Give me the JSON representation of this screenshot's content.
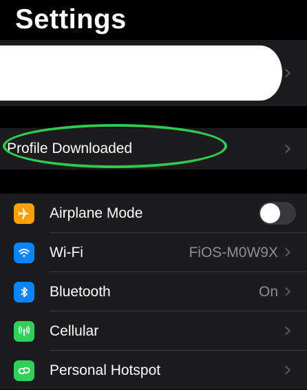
{
  "header": {
    "title": "Settings"
  },
  "profile": {
    "label": "Profile Downloaded"
  },
  "rows": [
    {
      "label": "Airplane Mode",
      "value": "",
      "icon": "airplane-icon",
      "color": "#ff9f0a"
    },
    {
      "label": "Wi-Fi",
      "value": "FiOS-M0W9X",
      "icon": "wifi-icon",
      "color": "#0a84ff"
    },
    {
      "label": "Bluetooth",
      "value": "On",
      "icon": "bluetooth-icon",
      "color": "#0a84ff"
    },
    {
      "label": "Cellular",
      "value": "",
      "icon": "cellular-icon",
      "color": "#30d158"
    },
    {
      "label": "Personal Hotspot",
      "value": "",
      "icon": "hotspot-icon",
      "color": "#30d158"
    }
  ],
  "airplane_mode_on": false
}
